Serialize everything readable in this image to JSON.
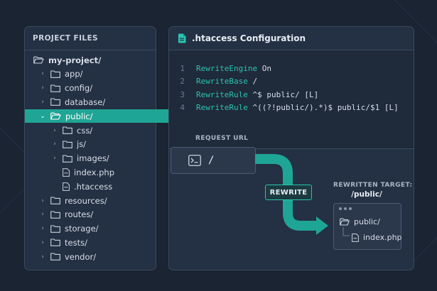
{
  "files_panel": {
    "title": "PROJECT FILES",
    "items": [
      {
        "label": "my-project/",
        "type": "folder-open",
        "chevron": ""
      },
      {
        "label": "app/",
        "type": "folder",
        "chevron": "›"
      },
      {
        "label": "config/",
        "type": "folder",
        "chevron": "›"
      },
      {
        "label": "database/",
        "type": "folder",
        "chevron": "›"
      },
      {
        "label": "public/",
        "type": "folder-open",
        "chevron": "⌄",
        "selected": true
      },
      {
        "label": "css/",
        "type": "folder",
        "chevron": "›"
      },
      {
        "label": "js/",
        "type": "folder",
        "chevron": "›"
      },
      {
        "label": "images/",
        "type": "folder",
        "chevron": "›"
      },
      {
        "label": "index.php",
        "type": "file",
        "chevron": ""
      },
      {
        "label": ".htaccess",
        "type": "file",
        "chevron": ""
      },
      {
        "label": "resources/",
        "type": "folder",
        "chevron": "›"
      },
      {
        "label": "routes/",
        "type": "folder",
        "chevron": "›"
      },
      {
        "label": "storage/",
        "type": "folder",
        "chevron": "›"
      },
      {
        "label": "tests/",
        "type": "folder",
        "chevron": "›"
      },
      {
        "label": "vendor/",
        "type": "folder",
        "chevron": "›"
      }
    ]
  },
  "config_panel": {
    "title": ".htaccess Configuration",
    "code_lines": [
      {
        "num": "1",
        "kw": "RewriteEngine",
        "rest": " On"
      },
      {
        "num": "2",
        "kw": "RewriteBase",
        "rest": " /"
      },
      {
        "num": "3",
        "kw": "RewriteRule",
        "rest": " ^$ public/ [L]"
      },
      {
        "num": "4",
        "kw": "RewriteRule",
        "rest": " ^((?!public/).*)$ public/$1 [L]"
      }
    ]
  },
  "diagram": {
    "request_label": "REQUEST URL",
    "request_value": "/",
    "rewrite_label": "REWRITE",
    "target_label": "REWRITTEN TARGET:",
    "target_path": "/public/",
    "target_folder": "public/",
    "target_file": "index.php"
  },
  "colors": {
    "accent": "#1fa595",
    "background": "#1b2432",
    "panel": "#243043"
  }
}
